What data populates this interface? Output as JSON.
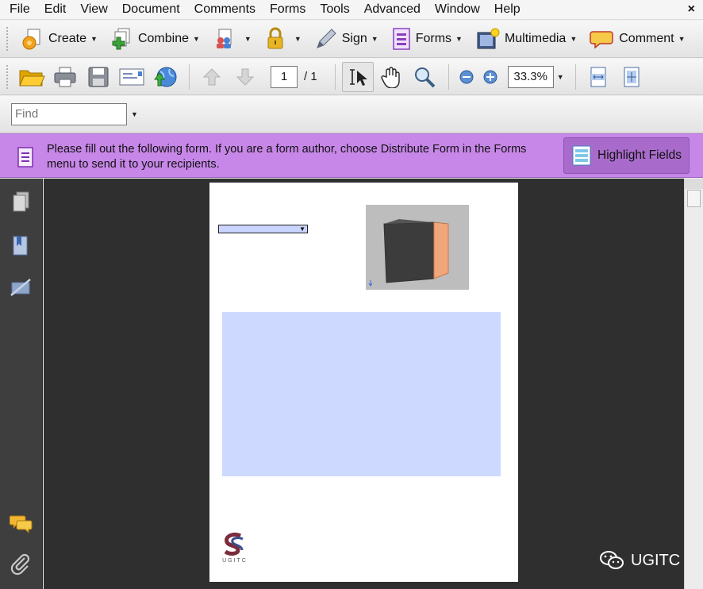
{
  "menu": {
    "items": [
      "File",
      "Edit",
      "View",
      "Document",
      "Comments",
      "Forms",
      "Tools",
      "Advanced",
      "Window",
      "Help"
    ],
    "close": "×"
  },
  "toolbar1": {
    "create": "Create",
    "combine": "Combine",
    "sign": "Sign",
    "forms": "Forms",
    "multimedia": "Multimedia",
    "comment": "Comment"
  },
  "toolbar2": {
    "current_page": "1",
    "total_pages": "/ 1",
    "zoom": "33.3%"
  },
  "toolbar3": {
    "find_placeholder": "Find"
  },
  "formbar": {
    "message": "Please fill out the following form. If you are a form author, choose Distribute Form in the Forms menu to send it to your recipients.",
    "highlight_button": "Highlight Fields"
  },
  "document": {
    "logo_text": "UGITC"
  },
  "watermark": {
    "text": "UGITC"
  },
  "colors": {
    "formbar_bg": "#c787e8",
    "field_highlight": "#cdd9ff",
    "doc_background": "#2f2f2f",
    "nav_panel": "#3e3e3e"
  }
}
